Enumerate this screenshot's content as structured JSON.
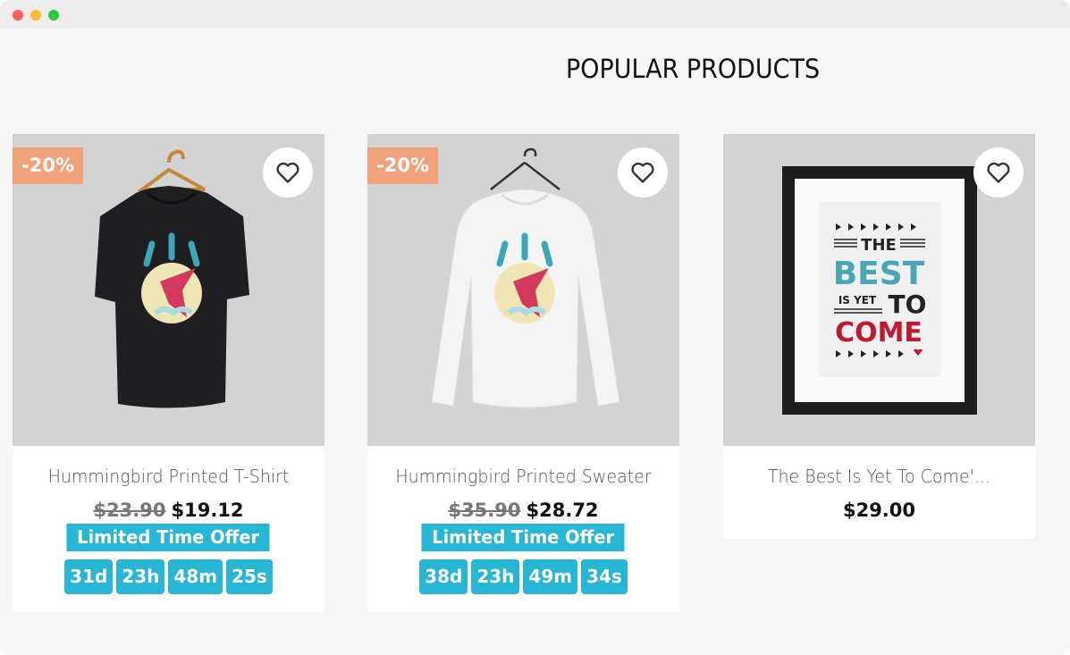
{
  "section": {
    "title": "POPULAR PRODUCTS"
  },
  "products": [
    {
      "badge": "-20%",
      "name": "Hummingbird Printed T-Shirt",
      "old_price": "$23.90",
      "price": "$19.12",
      "offer_label": "Limited Time Offer",
      "countdown": [
        "31d",
        "23h",
        "48m",
        "25s"
      ],
      "image": "black-tshirt-hummingbird"
    },
    {
      "badge": "-20%",
      "name": "Hummingbird Printed Sweater",
      "old_price": "$35.90",
      "price": "$28.72",
      "offer_label": "Limited Time Offer",
      "countdown": [
        "38d",
        "23h",
        "49m",
        "34s"
      ],
      "image": "white-sweater-hummingbird"
    },
    {
      "name": "The Best Is Yet To Come'...",
      "price": "$29.00",
      "image": "framed-poster",
      "poster": {
        "line1": "THE",
        "line2": "BEST",
        "line3a": "IS YET",
        "line3b": "TO",
        "line4": "COME"
      }
    }
  ],
  "colors": {
    "badge": "#f2a27a",
    "offer": "#27b6d4",
    "background": "#f6f6f6"
  },
  "icons": {
    "wishlist": "heart-outline-icon"
  }
}
